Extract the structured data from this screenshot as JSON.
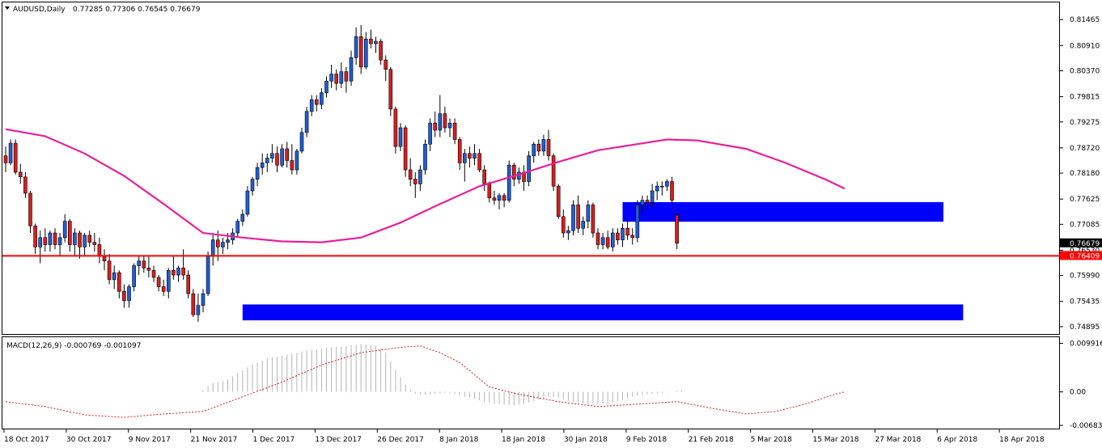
{
  "header": {
    "symbol": "AUDUSD,Daily",
    "ohlc": "0.77285 0.77306 0.76545 0.76679"
  },
  "macd_header": {
    "label": "MACD(12,26,9) -0.000769 -0.001097"
  },
  "colors": {
    "bull": "#1f5fd6",
    "bear": "#d62020",
    "ma": "#e8209a",
    "support": "#ff0000",
    "zone": "#0000ff",
    "signal": "#d62020",
    "hist": "#b4b4b4"
  },
  "chart_data": {
    "type": "candlestick",
    "price_axis": {
      "ticks": [
        "0.81465",
        "0.80910",
        "0.80370",
        "0.79815",
        "0.79275",
        "0.78720",
        "0.78180",
        "0.77625",
        "0.77085",
        "0.76530",
        "0.75990",
        "0.75435",
        "0.74895"
      ],
      "ylim": [
        0.7479,
        0.8159
      ]
    },
    "price_markers": [
      {
        "label": "0.76679",
        "value": 0.76679
      },
      {
        "label": "0.76409",
        "value": 0.76409
      }
    ],
    "x_tick_labels": [
      "18 Oct 2017",
      "30 Oct 2017",
      "9 Nov 2017",
      "21 Nov 2017",
      "1 Dec 2017",
      "13 Dec 2017",
      "26 Dec 2017",
      "8 Jan 2018",
      "18 Jan 2018",
      "30 Jan 2018",
      "9 Feb 2018",
      "21 Feb 2018",
      "5 Mar 2018",
      "15 Mar 2018",
      "27 Mar 2018",
      "6 Apr 2018",
      "18 Apr 2018"
    ],
    "support_level": 0.76409,
    "zones": [
      {
        "from_index": 125,
        "to_index": 190,
        "top": 0.7756,
        "bottom": 0.7714
      },
      {
        "from_index": 48,
        "to_index": 194,
        "top": 0.7537,
        "bottom": 0.7503
      }
    ],
    "ma_points": [
      [
        0,
        0.7912
      ],
      [
        8,
        0.7897
      ],
      [
        16,
        0.786
      ],
      [
        24,
        0.7812
      ],
      [
        32,
        0.7752
      ],
      [
        40,
        0.769
      ],
      [
        48,
        0.768
      ],
      [
        56,
        0.7672
      ],
      [
        64,
        0.767
      ],
      [
        72,
        0.768
      ],
      [
        80,
        0.7712
      ],
      [
        88,
        0.7752
      ],
      [
        96,
        0.779
      ],
      [
        104,
        0.7815
      ],
      [
        112,
        0.7842
      ],
      [
        120,
        0.7867
      ],
      [
        128,
        0.788
      ],
      [
        134,
        0.789
      ],
      [
        140,
        0.7888
      ],
      [
        150,
        0.787
      ],
      [
        158,
        0.784
      ],
      [
        166,
        0.7805
      ],
      [
        170,
        0.7785
      ]
    ],
    "candles": [
      [
        0.7855,
        0.7875,
        0.782,
        0.784
      ],
      [
        0.784,
        0.789,
        0.7835,
        0.7882
      ],
      [
        0.7882,
        0.789,
        0.7815,
        0.782
      ],
      [
        0.782,
        0.7838,
        0.7795,
        0.781
      ],
      [
        0.781,
        0.782,
        0.7765,
        0.7775
      ],
      [
        0.7775,
        0.778,
        0.769,
        0.7705
      ],
      [
        0.7705,
        0.771,
        0.7645,
        0.766
      ],
      [
        0.766,
        0.7695,
        0.7625,
        0.768
      ],
      [
        0.768,
        0.77,
        0.765,
        0.7665
      ],
      [
        0.7665,
        0.7695,
        0.765,
        0.769
      ],
      [
        0.769,
        0.77,
        0.7655,
        0.7665
      ],
      [
        0.7665,
        0.769,
        0.764,
        0.768
      ],
      [
        0.768,
        0.773,
        0.767,
        0.7715
      ],
      [
        0.7715,
        0.772,
        0.765,
        0.7665
      ],
      [
        0.7665,
        0.77,
        0.764,
        0.769
      ],
      [
        0.769,
        0.7695,
        0.7635,
        0.766
      ],
      [
        0.766,
        0.769,
        0.764,
        0.7685
      ],
      [
        0.7685,
        0.7695,
        0.766,
        0.767
      ],
      [
        0.767,
        0.769,
        0.765,
        0.7665
      ],
      [
        0.7665,
        0.768,
        0.7625,
        0.764
      ],
      [
        0.764,
        0.7655,
        0.761,
        0.763
      ],
      [
        0.763,
        0.7645,
        0.758,
        0.759
      ],
      [
        0.759,
        0.762,
        0.757,
        0.7605
      ],
      [
        0.7605,
        0.761,
        0.755,
        0.7565
      ],
      [
        0.7565,
        0.758,
        0.753,
        0.7545
      ],
      [
        0.7545,
        0.758,
        0.753,
        0.7575
      ],
      [
        0.7575,
        0.7625,
        0.7565,
        0.762
      ],
      [
        0.762,
        0.764,
        0.76,
        0.763
      ],
      [
        0.763,
        0.764,
        0.7605,
        0.7615
      ],
      [
        0.7615,
        0.764,
        0.7595,
        0.761
      ],
      [
        0.761,
        0.762,
        0.7585,
        0.7595
      ],
      [
        0.7595,
        0.76,
        0.7565,
        0.7575
      ],
      [
        0.7575,
        0.759,
        0.7555,
        0.7565
      ],
      [
        0.7565,
        0.7615,
        0.755,
        0.761
      ],
      [
        0.761,
        0.764,
        0.759,
        0.76
      ],
      [
        0.76,
        0.762,
        0.7585,
        0.7615
      ],
      [
        0.7615,
        0.7655,
        0.759,
        0.76
      ],
      [
        0.76,
        0.761,
        0.755,
        0.756
      ],
      [
        0.756,
        0.757,
        0.751,
        0.7515
      ],
      [
        0.7515,
        0.756,
        0.75,
        0.7535
      ],
      [
        0.7535,
        0.757,
        0.752,
        0.756
      ],
      [
        0.756,
        0.765,
        0.7555,
        0.764
      ],
      [
        0.764,
        0.769,
        0.762,
        0.7675
      ],
      [
        0.7675,
        0.7695,
        0.763,
        0.766
      ],
      [
        0.766,
        0.768,
        0.7645,
        0.767
      ],
      [
        0.767,
        0.769,
        0.7655,
        0.7675
      ],
      [
        0.7675,
        0.77,
        0.7665,
        0.769
      ],
      [
        0.769,
        0.772,
        0.768,
        0.7715
      ],
      [
        0.7715,
        0.774,
        0.7705,
        0.773
      ],
      [
        0.773,
        0.779,
        0.7725,
        0.778
      ],
      [
        0.778,
        0.781,
        0.777,
        0.7805
      ],
      [
        0.7805,
        0.784,
        0.779,
        0.783
      ],
      [
        0.783,
        0.786,
        0.7815,
        0.784
      ],
      [
        0.784,
        0.786,
        0.782,
        0.785
      ],
      [
        0.785,
        0.788,
        0.784,
        0.786
      ],
      [
        0.786,
        0.7875,
        0.782,
        0.7835
      ],
      [
        0.7835,
        0.788,
        0.783,
        0.787
      ],
      [
        0.787,
        0.7885,
        0.783,
        0.7845
      ],
      [
        0.7845,
        0.788,
        0.7815,
        0.7825
      ],
      [
        0.7825,
        0.787,
        0.7815,
        0.7865
      ],
      [
        0.7865,
        0.7915,
        0.786,
        0.7905
      ],
      [
        0.7905,
        0.796,
        0.7895,
        0.795
      ],
      [
        0.795,
        0.7985,
        0.794,
        0.7975
      ],
      [
        0.7975,
        0.7985,
        0.795,
        0.7965
      ],
      [
        0.7965,
        0.8,
        0.7955,
        0.799
      ],
      [
        0.799,
        0.8025,
        0.798,
        0.8015
      ],
      [
        0.8015,
        0.805,
        0.8,
        0.803
      ],
      [
        0.803,
        0.804,
        0.7995,
        0.801
      ],
      [
        0.801,
        0.8055,
        0.8,
        0.8035
      ],
      [
        0.8035,
        0.8045,
        0.799,
        0.8015
      ],
      [
        0.8015,
        0.808,
        0.8005,
        0.8065
      ],
      [
        0.8065,
        0.813,
        0.805,
        0.811
      ],
      [
        0.811,
        0.8135,
        0.803,
        0.8045
      ],
      [
        0.8045,
        0.812,
        0.804,
        0.8105
      ],
      [
        0.8105,
        0.8125,
        0.8085,
        0.8095
      ],
      [
        0.8095,
        0.811,
        0.8075,
        0.81
      ],
      [
        0.81,
        0.8105,
        0.805,
        0.806
      ],
      [
        0.806,
        0.807,
        0.8015,
        0.804
      ],
      [
        0.804,
        0.8045,
        0.794,
        0.7955
      ],
      [
        0.7955,
        0.796,
        0.786,
        0.7875
      ],
      [
        0.7875,
        0.7925,
        0.7865,
        0.7915
      ],
      [
        0.7915,
        0.792,
        0.781,
        0.7825
      ],
      [
        0.7825,
        0.785,
        0.779,
        0.7805
      ],
      [
        0.7805,
        0.782,
        0.7765,
        0.7795
      ],
      [
        0.7795,
        0.7835,
        0.778,
        0.7825
      ],
      [
        0.7825,
        0.789,
        0.7815,
        0.788
      ],
      [
        0.788,
        0.7935,
        0.7865,
        0.7925
      ],
      [
        0.7925,
        0.795,
        0.7895,
        0.791
      ],
      [
        0.791,
        0.7985,
        0.7895,
        0.7945
      ],
      [
        0.7945,
        0.796,
        0.7905,
        0.7915
      ],
      [
        0.7915,
        0.7935,
        0.7895,
        0.7925
      ],
      [
        0.7925,
        0.7935,
        0.788,
        0.789
      ],
      [
        0.789,
        0.7895,
        0.7825,
        0.784
      ],
      [
        0.784,
        0.787,
        0.78,
        0.786
      ],
      [
        0.786,
        0.7875,
        0.783,
        0.785
      ],
      [
        0.785,
        0.788,
        0.7835,
        0.786
      ],
      [
        0.786,
        0.787,
        0.782,
        0.7825
      ],
      [
        0.7825,
        0.7835,
        0.778,
        0.7795
      ],
      [
        0.7795,
        0.78,
        0.7755,
        0.7765
      ],
      [
        0.7765,
        0.778,
        0.775,
        0.776
      ],
      [
        0.776,
        0.7775,
        0.774,
        0.777
      ],
      [
        0.777,
        0.7775,
        0.7745,
        0.776
      ],
      [
        0.776,
        0.7845,
        0.7755,
        0.7835
      ],
      [
        0.7835,
        0.784,
        0.779,
        0.7805
      ],
      [
        0.7805,
        0.783,
        0.7795,
        0.782
      ],
      [
        0.782,
        0.7835,
        0.778,
        0.78
      ],
      [
        0.78,
        0.7865,
        0.779,
        0.7855
      ],
      [
        0.7855,
        0.7885,
        0.784,
        0.788
      ],
      [
        0.788,
        0.789,
        0.7855,
        0.7865
      ],
      [
        0.7865,
        0.79,
        0.7855,
        0.789
      ],
      [
        0.789,
        0.791,
        0.7845,
        0.7855
      ],
      [
        0.7855,
        0.786,
        0.778,
        0.779
      ],
      [
        0.779,
        0.7795,
        0.772,
        0.7725
      ],
      [
        0.7725,
        0.774,
        0.768,
        0.769
      ],
      [
        0.769,
        0.7705,
        0.7675,
        0.7695
      ],
      [
        0.7695,
        0.776,
        0.7685,
        0.775
      ],
      [
        0.775,
        0.777,
        0.769,
        0.77
      ],
      [
        0.77,
        0.7725,
        0.7685,
        0.7715
      ],
      [
        0.7715,
        0.776,
        0.77,
        0.775
      ],
      [
        0.775,
        0.7755,
        0.768,
        0.769
      ],
      [
        0.769,
        0.77,
        0.7655,
        0.7665
      ],
      [
        0.7665,
        0.769,
        0.7655,
        0.768
      ],
      [
        0.768,
        0.7695,
        0.7655,
        0.766
      ],
      [
        0.766,
        0.77,
        0.765,
        0.769
      ],
      [
        0.769,
        0.77,
        0.7665,
        0.7675
      ],
      [
        0.7675,
        0.771,
        0.766,
        0.77
      ],
      [
        0.77,
        0.772,
        0.7675,
        0.7685
      ],
      [
        0.7685,
        0.77,
        0.7665,
        0.768
      ],
      [
        0.768,
        0.776,
        0.767,
        0.775
      ],
      [
        0.775,
        0.777,
        0.7735,
        0.776
      ],
      [
        0.776,
        0.777,
        0.774,
        0.7755
      ],
      [
        0.7755,
        0.7795,
        0.7745,
        0.778
      ],
      [
        0.778,
        0.78,
        0.776,
        0.779
      ],
      [
        0.779,
        0.78,
        0.777,
        0.779
      ],
      [
        0.779,
        0.7805,
        0.778,
        0.78
      ],
      [
        0.78,
        0.781,
        0.775,
        0.776
      ],
      [
        0.7728,
        0.7731,
        0.7655,
        0.7668
      ]
    ],
    "macd": {
      "ylim": [
        -0.007,
        0.0105
      ],
      "ticks": [
        "0.009916",
        "0.00",
        "-0.006838"
      ],
      "histogram": [
        0.0,
        0.0,
        0.0,
        0.0,
        0.0,
        0.0,
        0.0,
        0.0,
        0.0,
        0.0,
        0.0,
        0.0,
        0.0,
        0.0,
        0.0,
        0.0,
        0.0,
        0.0,
        0.0,
        0.0,
        0.0,
        0.0,
        0.0,
        0.0,
        0.0,
        0.0,
        0.0,
        0.0,
        0.0,
        0.0,
        0.0,
        0.0,
        0.0,
        0.0,
        0.0,
        0.0,
        0.0,
        0.0,
        0.0,
        0.0,
        0.0004,
        0.0012,
        0.0018,
        0.002,
        0.0022,
        0.0026,
        0.0032,
        0.0038,
        0.0044,
        0.005,
        0.0056,
        0.006,
        0.0064,
        0.0068,
        0.007,
        0.0072,
        0.0074,
        0.0076,
        0.0078,
        0.008,
        0.0082,
        0.0084,
        0.0086,
        0.0087,
        0.0088,
        0.009,
        0.0091,
        0.0092,
        0.0093,
        0.0094,
        0.0095,
        0.0096,
        0.0097,
        0.0097,
        0.0096,
        0.0094,
        0.009,
        0.008,
        0.0062,
        0.0045,
        0.003,
        0.0015,
        0.0004,
        -0.0004,
        -0.0006,
        -0.0006,
        -0.0005,
        -0.0004,
        -0.0003,
        -0.0002,
        -0.0002,
        -0.0004,
        -0.0007,
        -0.001,
        -0.0012,
        -0.0014,
        -0.0017,
        -0.002,
        -0.0022,
        -0.0024,
        -0.0025,
        -0.0026,
        -0.0027,
        -0.0027,
        -0.0026,
        -0.0024,
        -0.0022,
        -0.0019,
        -0.0016,
        -0.0013,
        -0.001,
        -0.001,
        -0.0012,
        -0.0015,
        -0.0018,
        -0.002,
        -0.0022,
        -0.0024,
        -0.0025,
        -0.0026,
        -0.0026,
        -0.0025,
        -0.0024,
        -0.0022,
        -0.0019,
        -0.0016,
        -0.0013,
        -0.001,
        -0.0008,
        -0.0006,
        -0.0005,
        -0.0004,
        -0.0003,
        -0.0002,
        -0.0001,
        0.0,
        0.0002,
        0.0004
      ],
      "signal_points": [
        [
          0,
          -0.002
        ],
        [
          8,
          -0.003
        ],
        [
          16,
          -0.0047
        ],
        [
          24,
          -0.0052
        ],
        [
          32,
          -0.0045
        ],
        [
          40,
          -0.004
        ],
        [
          48,
          -0.001
        ],
        [
          56,
          0.002
        ],
        [
          64,
          0.0055
        ],
        [
          72,
          0.008
        ],
        [
          80,
          0.0091
        ],
        [
          84,
          0.0094
        ],
        [
          88,
          0.008
        ],
        [
          92,
          0.006
        ],
        [
          98,
          0.001
        ],
        [
          104,
          -0.0005
        ],
        [
          112,
          -0.002
        ],
        [
          120,
          -0.003
        ],
        [
          128,
          -0.0025
        ],
        [
          136,
          -0.002
        ],
        [
          144,
          -0.0035
        ],
        [
          150,
          -0.0045
        ],
        [
          156,
          -0.004
        ],
        [
          162,
          -0.0025
        ],
        [
          168,
          -0.0005
        ],
        [
          170,
          0.0
        ]
      ]
    }
  }
}
